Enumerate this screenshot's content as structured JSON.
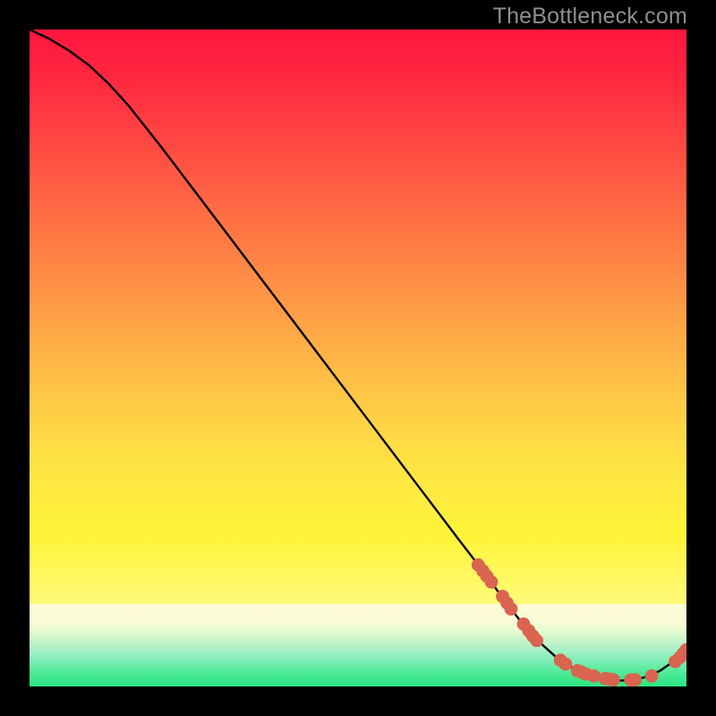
{
  "watermark": "TheBottleneck.com",
  "colors": {
    "black": "#000000",
    "curve": "#000000",
    "dot": "#d9644f",
    "cream": "#fffbd8",
    "green_lo": "#2fe989",
    "green_hi": "#97f2c1"
  },
  "chart_data": {
    "type": "line",
    "title": "",
    "xlabel": "",
    "ylabel": "",
    "xlim": [
      0,
      100
    ],
    "ylim": [
      0,
      100
    ],
    "grid": false,
    "curve": [
      {
        "x": 0.0,
        "y": 100.0
      },
      {
        "x": 3.0,
        "y": 98.6
      },
      {
        "x": 6.0,
        "y": 96.8
      },
      {
        "x": 9.0,
        "y": 94.6
      },
      {
        "x": 12.0,
        "y": 91.8
      },
      {
        "x": 15.0,
        "y": 88.5
      },
      {
        "x": 20.0,
        "y": 82.2
      },
      {
        "x": 25.0,
        "y": 75.6
      },
      {
        "x": 30.0,
        "y": 69.0
      },
      {
        "x": 35.0,
        "y": 62.4
      },
      {
        "x": 40.0,
        "y": 55.8
      },
      {
        "x": 45.0,
        "y": 49.2
      },
      {
        "x": 50.0,
        "y": 42.6
      },
      {
        "x": 55.0,
        "y": 36.0
      },
      {
        "x": 60.0,
        "y": 29.4
      },
      {
        "x": 65.0,
        "y": 22.8
      },
      {
        "x": 70.0,
        "y": 16.3
      },
      {
        "x": 72.0,
        "y": 13.5
      },
      {
        "x": 75.0,
        "y": 9.6
      },
      {
        "x": 78.0,
        "y": 6.4
      },
      {
        "x": 80.0,
        "y": 4.6
      },
      {
        "x": 82.0,
        "y": 3.2
      },
      {
        "x": 84.0,
        "y": 2.1
      },
      {
        "x": 86.0,
        "y": 1.4
      },
      {
        "x": 88.0,
        "y": 1.0
      },
      {
        "x": 90.0,
        "y": 0.9
      },
      {
        "x": 92.0,
        "y": 1.0
      },
      {
        "x": 94.0,
        "y": 1.5
      },
      {
        "x": 96.0,
        "y": 2.4
      },
      {
        "x": 98.0,
        "y": 3.8
      },
      {
        "x": 100.0,
        "y": 5.6
      }
    ],
    "dots": [
      {
        "x": 68.3,
        "y": 18.5
      },
      {
        "x": 69.0,
        "y": 17.6
      },
      {
        "x": 69.6,
        "y": 16.8
      },
      {
        "x": 70.3,
        "y": 15.9
      },
      {
        "x": 72.0,
        "y": 13.7
      },
      {
        "x": 72.7,
        "y": 12.7
      },
      {
        "x": 73.3,
        "y": 11.8
      },
      {
        "x": 75.2,
        "y": 9.5
      },
      {
        "x": 76.0,
        "y": 8.5
      },
      {
        "x": 76.6,
        "y": 7.7
      },
      {
        "x": 77.2,
        "y": 7.0
      },
      {
        "x": 80.8,
        "y": 4.0
      },
      {
        "x": 81.6,
        "y": 3.4
      },
      {
        "x": 83.4,
        "y": 2.4
      },
      {
        "x": 84.0,
        "y": 2.2
      },
      {
        "x": 84.7,
        "y": 1.9
      },
      {
        "x": 85.9,
        "y": 1.6
      },
      {
        "x": 87.6,
        "y": 1.2
      },
      {
        "x": 88.3,
        "y": 1.1
      },
      {
        "x": 88.9,
        "y": 1.0
      },
      {
        "x": 91.5,
        "y": 1.0
      },
      {
        "x": 92.2,
        "y": 1.0
      },
      {
        "x": 94.7,
        "y": 1.6
      },
      {
        "x": 98.3,
        "y": 3.8
      },
      {
        "x": 99.0,
        "y": 4.4
      },
      {
        "x": 99.5,
        "y": 5.0
      },
      {
        "x": 100.0,
        "y": 5.6
      }
    ]
  }
}
